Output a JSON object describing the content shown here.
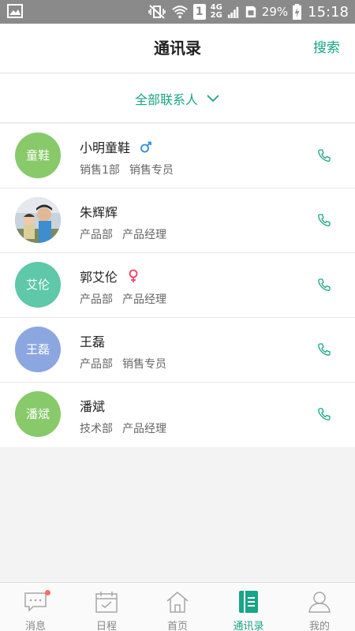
{
  "status_bar": {
    "network_4g": "4G",
    "network_2g": "2G",
    "battery": "29%",
    "time": "15:18",
    "sim_label": "1"
  },
  "header": {
    "title": "通讯录",
    "search_label": "搜索"
  },
  "filter": {
    "label": "全部联系人"
  },
  "contacts": [
    {
      "avatar_text": "童鞋",
      "avatar_color": "#88c96a",
      "name": "小明童鞋",
      "gender": "male",
      "department": "销售1部",
      "position": "销售专员"
    },
    {
      "avatar_text": "",
      "avatar_color": "#9aa8b4",
      "name": "朱辉辉",
      "gender": "",
      "department": "产品部",
      "position": "产品经理"
    },
    {
      "avatar_text": "艾伦",
      "avatar_color": "#5ec8a8",
      "name": "郭艾伦",
      "gender": "female",
      "department": "产品部",
      "position": "产品经理"
    },
    {
      "avatar_text": "王磊",
      "avatar_color": "#8ca7e0",
      "name": "王磊",
      "gender": "",
      "department": "产品部",
      "position": "销售专员"
    },
    {
      "avatar_text": "潘斌",
      "avatar_color": "#88c96a",
      "name": "潘斌",
      "gender": "",
      "department": "技术部",
      "position": "产品经理"
    }
  ],
  "tabs": [
    {
      "label": "消息",
      "icon": "message-icon"
    },
    {
      "label": "日程",
      "icon": "calendar-icon"
    },
    {
      "label": "首页",
      "icon": "home-icon"
    },
    {
      "label": "通讯录",
      "icon": "contacts-icon"
    },
    {
      "label": "我的",
      "icon": "profile-icon"
    }
  ],
  "colors": {
    "accent": "#19a587",
    "male": "#2f8fe0",
    "female": "#ff3b64",
    "badge": "#ff6a6a"
  }
}
